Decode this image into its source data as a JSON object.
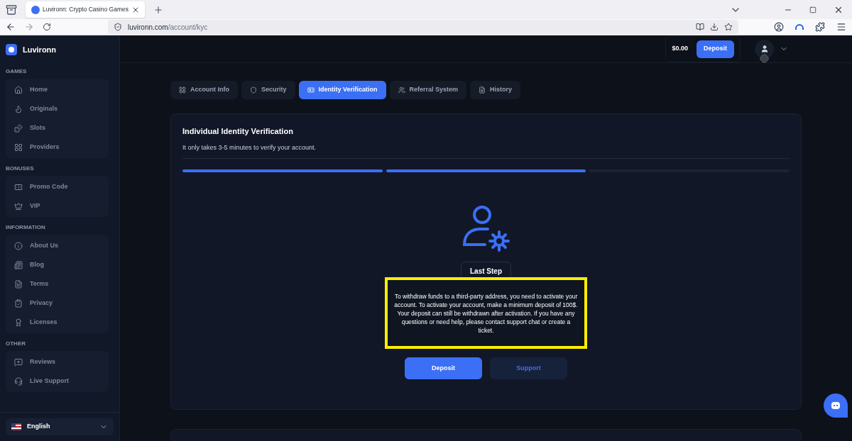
{
  "browser": {
    "tab_title": "Luvironn: Crypto Casino Games",
    "url_domain": "luvironn.com",
    "url_path": "/account/kyc"
  },
  "sidebar": {
    "brand": "Luvironn",
    "sections": [
      {
        "title": "GAMES",
        "items": [
          {
            "label": "Home"
          },
          {
            "label": "Originals"
          },
          {
            "label": "Slots"
          },
          {
            "label": "Providers"
          }
        ]
      },
      {
        "title": "BONUSES",
        "items": [
          {
            "label": "Promo Code"
          },
          {
            "label": "VIP"
          }
        ]
      },
      {
        "title": "INFORMATION",
        "items": [
          {
            "label": "About Us"
          },
          {
            "label": "Blog"
          },
          {
            "label": "Terms"
          },
          {
            "label": "Privacy"
          },
          {
            "label": "Licenses"
          }
        ]
      },
      {
        "title": "OTHER",
        "items": [
          {
            "label": "Reviews"
          },
          {
            "label": "Live Support"
          }
        ]
      }
    ],
    "language": "English"
  },
  "header": {
    "balance": "$0.00",
    "deposit": "Deposit"
  },
  "tabs": [
    {
      "label": "Account Info",
      "selected": false
    },
    {
      "label": "Security",
      "selected": false
    },
    {
      "label": "Identity Verification",
      "selected": true
    },
    {
      "label": "Referral System",
      "selected": false
    },
    {
      "label": "History",
      "selected": false
    }
  ],
  "card": {
    "title": "Individual Identity Verification",
    "subtitle": "It only takes 3-5 minutes to verify your account.",
    "steps": [
      {
        "completed": true
      },
      {
        "completed": true
      },
      {
        "completed": false
      }
    ],
    "step_label": "Last Step",
    "message": "To withdraw funds to a third-party address, you need to activate your account. To activate your account, make a minimum deposit of 100$. Your deposit can still be withdrawn after activation. If you have any questions or need help, please contact support chat or create a ticket.",
    "buttons": [
      {
        "label": "Deposit",
        "kind": "primary"
      },
      {
        "label": "Support",
        "kind": "secondary"
      }
    ]
  }
}
